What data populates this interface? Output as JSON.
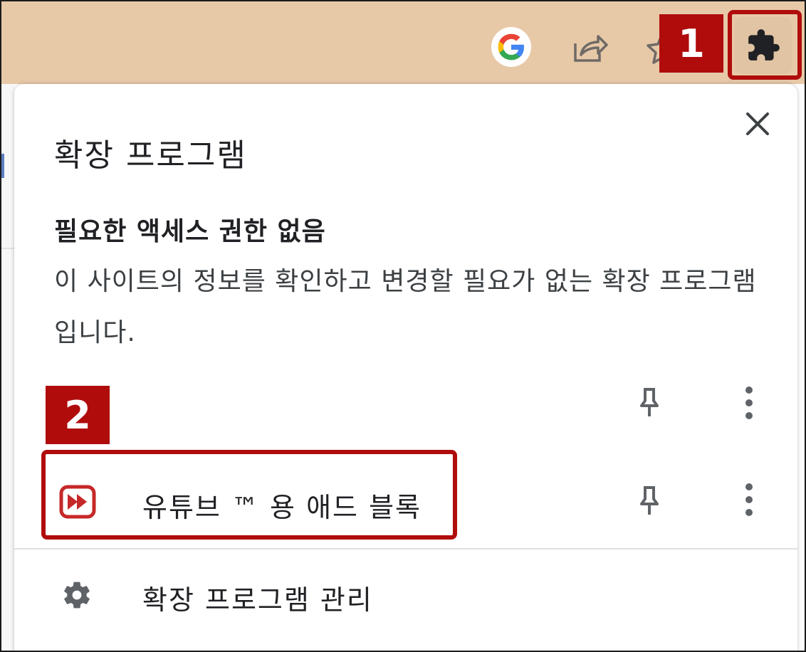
{
  "toolbar": {
    "icons": [
      "google-icon",
      "share-icon",
      "bookmark-star-icon",
      "extensions-puzzle-icon"
    ]
  },
  "callouts": {
    "first": "1",
    "second": "2",
    "color": "#b00c0c"
  },
  "panel": {
    "title": "확장 프로그램",
    "section_heading": "필요한 액세스 권한 없음",
    "section_description": "이 사이트의 정보를 확인하고 변경할 필요가 없는 확장 프로그램입니다.",
    "extension": {
      "name": "유튜브 ™ 용 애드 블록",
      "icon": "adblock-youtube-icon",
      "icon_color": "#c62828"
    },
    "manage_label": "확장 프로그램 관리"
  }
}
